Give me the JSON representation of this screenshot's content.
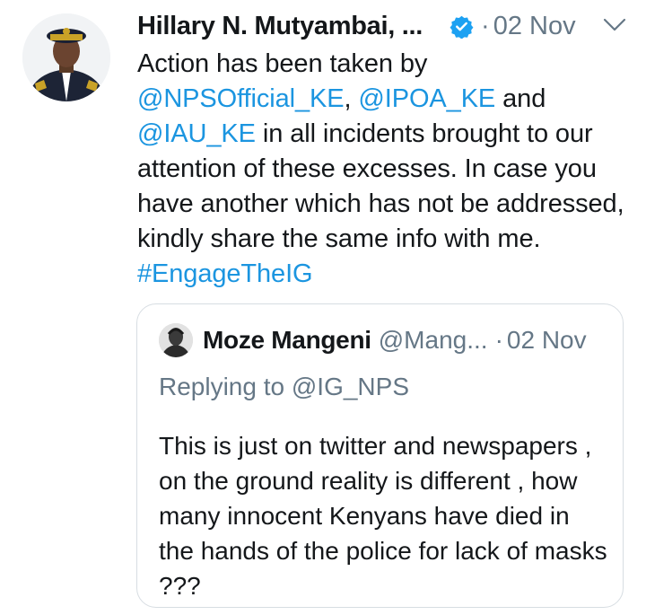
{
  "tweet": {
    "author_name": "Hillary N. Mutyambai, ...",
    "separator": "·",
    "date": "02 Nov",
    "body": [
      {
        "text": "Action has been taken by ",
        "link": false
      },
      {
        "text": "@NPSOfficial_KE",
        "link": true
      },
      {
        "text": ", ",
        "link": false
      },
      {
        "text": "@IPOA_KE",
        "link": true
      },
      {
        "text": " and ",
        "link": false
      },
      {
        "text": "@IAU_KE",
        "link": true
      },
      {
        "text": " in all incidents brought to our attention of these excesses. In case you have another which has not be addressed, kindly share the same info with me. ",
        "link": false
      },
      {
        "text": "#EngageTheIG",
        "link": true
      }
    ]
  },
  "quote": {
    "author_name": "Moze Mangeni",
    "handle": "@Mang...",
    "separator": "·",
    "date": "02 Nov",
    "replying_to": "Replying to @IG_NPS",
    "text": "This is just on twitter and newspapers , on the ground reality is different , how many innocent Kenyans have died in the hands of the police for lack of masks ???"
  },
  "colors": {
    "link": "#1b95e0",
    "muted": "#657786",
    "verified": "#1da1f2",
    "border": "#d7dde2"
  }
}
